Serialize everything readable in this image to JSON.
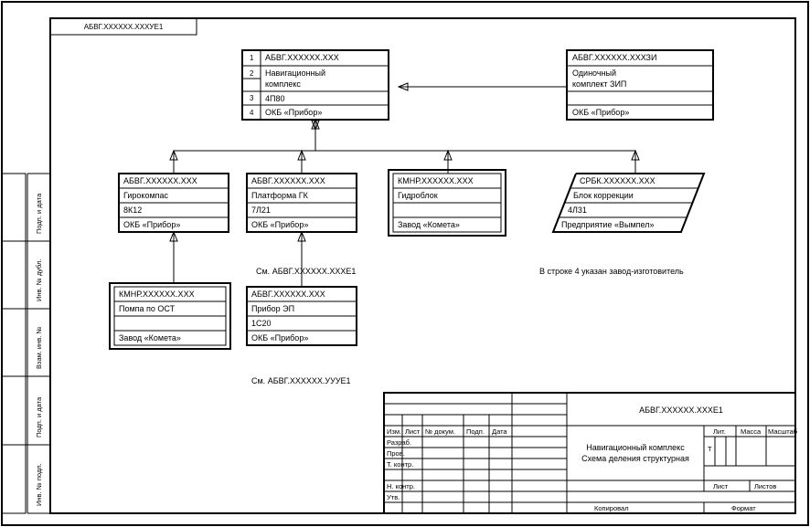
{
  "topCorner": "АБВГ.ХХХХХХ.ХХХУЕ1",
  "root": {
    "idxLabels": [
      "1",
      "2",
      "3",
      "4"
    ],
    "code": "АБВГ.ХХХХХХ.ХХХ",
    "name1": "Навигационный",
    "name2": "комплекс",
    "designation": "4П80",
    "maker": "ОКБ «Прибор»"
  },
  "zip": {
    "code": "АБВГ.ХХХХХХ.ХХХЗИ",
    "name1": "Одиночный",
    "name2": "комплект ЗИП",
    "maker": "ОКБ «Прибор»"
  },
  "gyro": {
    "code": "АБВГ.ХХХХХХ.ХХХ",
    "name": "Гирокомпас",
    "designation": "8К12",
    "maker": "ОКБ «Прибор»"
  },
  "plat": {
    "code": "АБВГ.ХХХХХХ.ХХХ",
    "name": "Платформа ГК",
    "designation": "7Л21",
    "maker": "ОКБ «Прибор»"
  },
  "platNote": "См. АБВГ.ХХХХХХ.ХХХЕ1",
  "hydr": {
    "code": "КМНР.ХХХХХХ.ХХХ",
    "name": "Гидроблок",
    "maker": "Завод «Комета»"
  },
  "corr": {
    "code": "СРБК.ХХХХХХ.ХХХ",
    "name": "Блок коррекции",
    "designation": "4Л31",
    "maker": "Предприятие «Вымпел»"
  },
  "corrNote": "В строке 4 указан завод-изготовитель",
  "pump": {
    "code": "КМНР.ХХХХХХ.ХХХ",
    "name": "Помпа по ОСТ",
    "maker": "Завод «Комета»"
  },
  "ep": {
    "code": "АБВГ.ХХХХХХ.ХХХ",
    "name": "Прибор ЭП",
    "designation": "1С20",
    "maker": "ОКБ «Прибор»"
  },
  "epNote": "См. АБВГ.ХХХХХХ.УУУЕ1",
  "sideLabels": [
    "Подп. и дата",
    "Инв. № дубл.",
    "Взам. инв. №",
    "Подп. и дата",
    "Инв. № подл."
  ],
  "title": {
    "docCode": "АБВГ.ХХХХХХ.ХХХЕ1",
    "docName1": "Навигационный комплекс",
    "docName2": "Схема деления структурная",
    "row": [
      "Изм.",
      "Лист",
      "№ докум.",
      "Подп.",
      "Дата"
    ],
    "rows": [
      "Разраб.",
      "Пров.",
      "Т. контр.",
      "Н. контр.",
      "Утв."
    ],
    "lit": "Лит.",
    "mass": "Масса",
    "scale": "Масштаб",
    "T": "Т",
    "sheet": "Лист",
    "sheets": "Листов",
    "kopiroval": "Копировал",
    "format": "Формат"
  }
}
